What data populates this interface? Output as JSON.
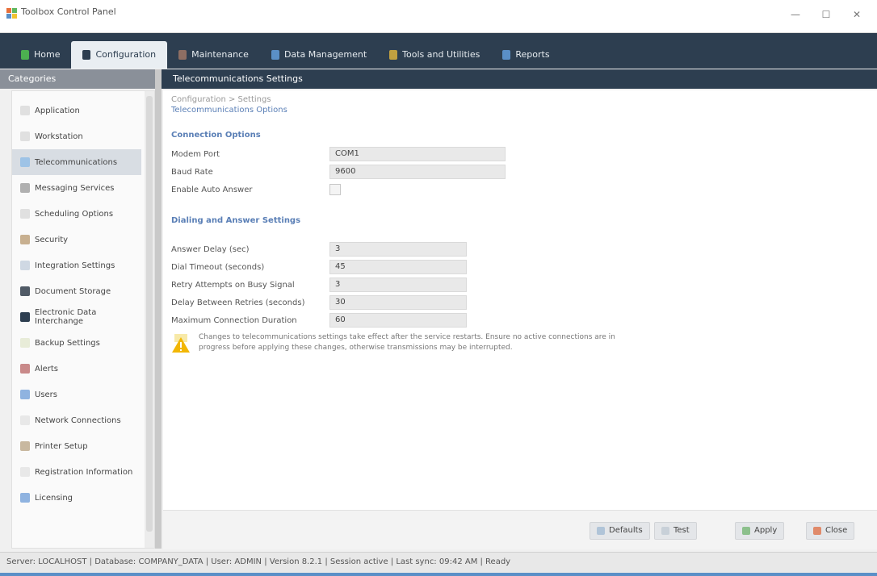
{
  "window": {
    "title": "Toolbox Control Panel",
    "controls": [
      "—",
      "☐",
      "✕"
    ]
  },
  "menu": {
    "tabs": [
      {
        "label": "Home",
        "icon": "home-icon",
        "color": "#4caf50"
      },
      {
        "label": "Configuration",
        "icon": "gear-icon",
        "color": "#2d3e50",
        "active": true
      },
      {
        "label": "Maintenance",
        "icon": "wrench-icon",
        "color": "#8d6e63"
      },
      {
        "label": "Data Management",
        "icon": "database-icon",
        "color": "#5a8fc7"
      },
      {
        "label": "Tools and Utilities",
        "icon": "tools-icon",
        "color": "#c0a040"
      },
      {
        "label": "Reports",
        "icon": "report-icon",
        "color": "#5a8fc7"
      }
    ]
  },
  "sidebar": {
    "header": "Categories",
    "items": [
      {
        "label": "Application",
        "icon": "app-icon",
        "color": "#e0e0e0"
      },
      {
        "label": "Workstation",
        "icon": "monitor-icon",
        "color": "#e0e0e0"
      },
      {
        "label": "Telecommunications",
        "icon": "phone-icon",
        "color": "#9ec3e6",
        "active": true
      },
      {
        "label": "Messaging Services",
        "icon": "mail-icon",
        "color": "#b0b0b0"
      },
      {
        "label": "Scheduling Options",
        "icon": "calendar-icon",
        "color": "#e0e0e0"
      },
      {
        "label": "Security",
        "icon": "lock-icon",
        "color": "#c8b090"
      },
      {
        "label": "Integration Settings",
        "icon": "link-icon",
        "color": "#cfd8e3"
      },
      {
        "label": "Document Storage",
        "icon": "folder-icon",
        "color": "#505a66"
      },
      {
        "label": "Electronic Data Interchange",
        "icon": "exchange-icon",
        "color": "#2d3e50"
      },
      {
        "label": "Backup Settings",
        "icon": "backup-icon",
        "color": "#e8ecd8"
      },
      {
        "label": "Alerts",
        "icon": "alert-icon",
        "color": "#c98a8a"
      },
      {
        "label": "Users",
        "icon": "users-icon",
        "color": "#8fb3e0"
      },
      {
        "label": "Network Connections",
        "icon": "network-icon",
        "color": "#e8e8e8"
      },
      {
        "label": "Printer Setup",
        "icon": "printer-icon",
        "color": "#c8b8a0"
      },
      {
        "label": "Registration Information",
        "icon": "info-icon",
        "color": "#e8e8e8"
      },
      {
        "label": "Licensing",
        "icon": "license-icon",
        "color": "#8fb3e0"
      }
    ]
  },
  "content": {
    "header": "Telecommunications Settings",
    "breadcrumb_top": "Configuration > Settings",
    "breadcrumb": "Telecommunications Options",
    "section1": {
      "title": "Connection Options",
      "rows": [
        {
          "label": "Modem Port",
          "value": "COM1"
        },
        {
          "label": "Baud Rate",
          "value": "9600"
        },
        {
          "label": "Enable Auto Answer"
        }
      ]
    },
    "section2": {
      "title": "Dialing and Answer Settings",
      "rows": [
        {
          "label": "Answer Delay (sec)",
          "value": "3"
        },
        {
          "label": "Dial Timeout (seconds)",
          "value": "45"
        },
        {
          "label": "Retry Attempts on Busy Signal",
          "value": "3"
        },
        {
          "label": "Delay Between Retries (seconds)",
          "value": "30"
        },
        {
          "label": "Maximum Connection Duration",
          "value": "60"
        }
      ]
    },
    "warning": "Changes to telecommunications settings take effect after the service restarts. Ensure no active connections are in progress before applying these changes, otherwise transmissions may be interrupted."
  },
  "buttons": [
    {
      "label": "Defaults",
      "icon": "defaults-icon",
      "color": "#b0c4d8"
    },
    {
      "label": "Test",
      "icon": "test-icon",
      "color": "#c8d0d8"
    },
    {
      "label": "Apply",
      "icon": "apply-icon",
      "color": "#8cc08c"
    },
    {
      "label": "Close",
      "icon": "close-icon",
      "color": "#e08a6a"
    }
  ],
  "status": {
    "text": "Server: LOCALHOST | Database: COMPANY_DATA | User: ADMIN | Version 8.2.1 | Session active | Last sync: 09:42 AM | Ready"
  }
}
